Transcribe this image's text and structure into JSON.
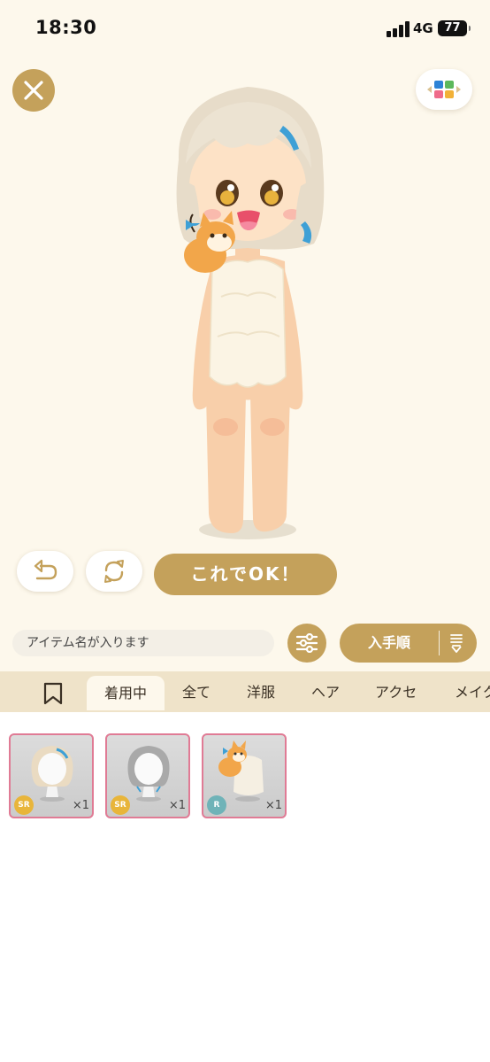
{
  "status": {
    "time": "18:30",
    "network": "4G",
    "battery": "77"
  },
  "actions": {
    "ok_label": "これでOK！"
  },
  "search": {
    "placeholder": "アイテム名が入ります"
  },
  "sort": {
    "label": "入手順"
  },
  "tabs": [
    {
      "label": "着用中"
    },
    {
      "label": "全て"
    },
    {
      "label": "洋服"
    },
    {
      "label": "ヘア"
    },
    {
      "label": "アクセ"
    },
    {
      "label": "メイク"
    }
  ],
  "items": [
    {
      "rarity": "SR",
      "quantity": "×1",
      "icon": "blonde-hair-icon"
    },
    {
      "rarity": "SR",
      "quantity": "×1",
      "icon": "gray-hair-icon"
    },
    {
      "rarity": "R",
      "quantity": "×1",
      "icon": "cat-fluffy-outfit-icon"
    }
  ],
  "colors": {
    "accent": "#c4a15b",
    "background": "#fdf8ec",
    "tab_bar": "#efe3c9",
    "item_border": "#e07b95",
    "rarity_sr": "#e8b53a",
    "rarity_r": "#6fb3b8"
  }
}
